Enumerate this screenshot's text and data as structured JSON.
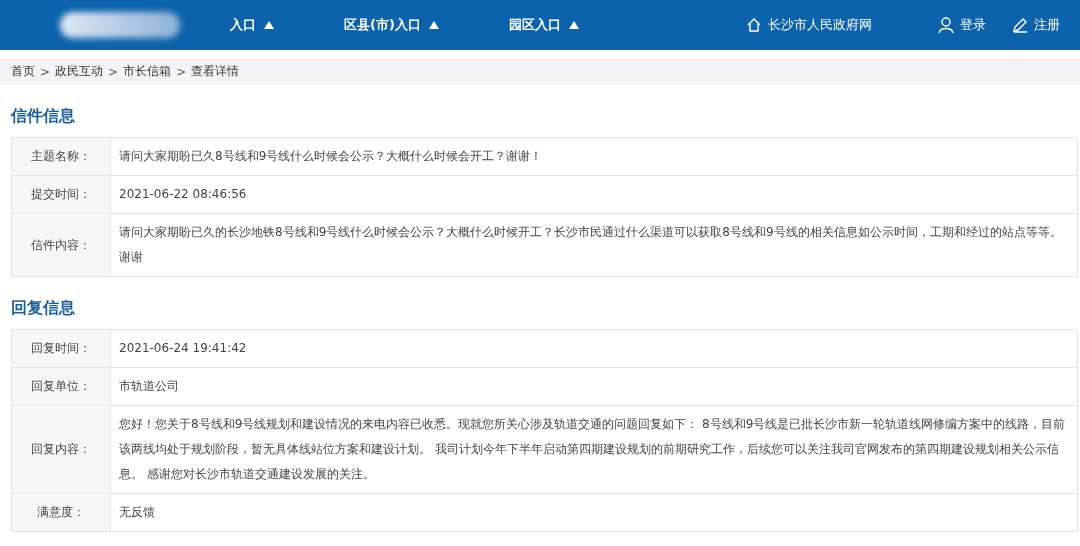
{
  "header": {
    "nav": [
      {
        "label": "入口",
        "expanded": false
      },
      {
        "label": "区县(市)入口",
        "expanded": false
      },
      {
        "label": "园区入口",
        "expanded": false
      }
    ],
    "gov_link": "长沙市人民政府网",
    "login": "登录",
    "register": "注册"
  },
  "breadcrumb": [
    {
      "label": "首页"
    },
    {
      "sep": ">",
      "label": "政民互动"
    },
    {
      "sep": ">",
      "label": "市长信箱"
    },
    {
      "sep": ">",
      "label": "查看详情"
    }
  ],
  "sections": [
    {
      "title": "信件信息",
      "rows": [
        {
          "label": "主题名称：",
          "value": "请问大家期盼已久8号线和9号线什么时候会公示？大概什么时候会开工？谢谢！"
        },
        {
          "label": "提交时间：",
          "value": "2021-06-22 08:46:56"
        },
        {
          "label": "信件内容：",
          "value": "请问大家期盼已久的长沙地铁8号线和9号线什么时候会公示？大概什么时候开工？长沙市民通过什么渠道可以获取8号线和9号线的相关信息如公示时间，工期和经过的站点等等。谢谢"
        }
      ]
    },
    {
      "title": "回复信息",
      "rows": [
        {
          "label": "回复时间：",
          "value": "2021-06-24 19:41:42"
        },
        {
          "label": "回复单位：",
          "value": "市轨道公司"
        },
        {
          "label": "回复内容：",
          "value": "您好！您关于8号线和9号线规划和建设情况的来电内容已收悉。现就您所关心涉及轨道交通的问题回复如下： 8号线和9号线是已批长沙市新一轮轨道线网修编方案中的线路，目前该两线均处于规划阶段，暂无具体线站位方案和建设计划。 我司计划今年下半年启动第四期建设规划的前期研究工作，后续您可以关注我司官网发布的第四期建设规划相关公示信息。 感谢您对长沙市轨道交通建设发展的关注。"
        },
        {
          "label": "满意度：",
          "value": "无反馈"
        }
      ]
    }
  ]
}
